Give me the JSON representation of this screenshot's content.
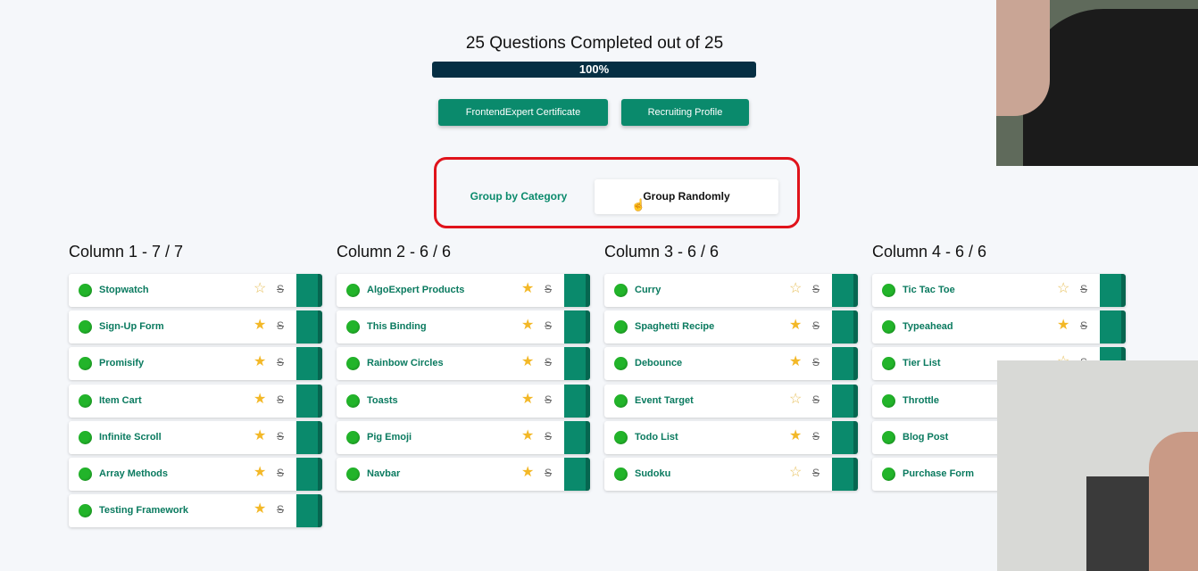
{
  "progress": {
    "title": "25 Questions Completed out of 25",
    "percent_label": "100%",
    "percent": 100
  },
  "buttons": {
    "certificate": "FrontendExpert Certificate",
    "recruiting": "Recruiting Profile"
  },
  "grouping": {
    "by_category": "Group by Category",
    "randomly": "Group Randomly",
    "selected": "randomly"
  },
  "colors": {
    "accent": "#0a8a6c",
    "dark_bar": "#062f43",
    "complete_dot": "#22b42a",
    "star": "#f3b827",
    "highlight": "#e0131b"
  },
  "columns": [
    {
      "title": "Column 1 - 7 / 7",
      "questions": [
        {
          "name": "Stopwatch",
          "starred": false
        },
        {
          "name": "Sign-Up Form",
          "starred": true
        },
        {
          "name": "Promisify",
          "starred": true
        },
        {
          "name": "Item Cart",
          "starred": true
        },
        {
          "name": "Infinite Scroll",
          "starred": true
        },
        {
          "name": "Array Methods",
          "starred": true
        },
        {
          "name": "Testing Framework",
          "starred": true
        }
      ]
    },
    {
      "title": "Column 2 - 6 / 6",
      "questions": [
        {
          "name": "AlgoExpert Products",
          "starred": true
        },
        {
          "name": "This Binding",
          "starred": true
        },
        {
          "name": "Rainbow Circles",
          "starred": true
        },
        {
          "name": "Toasts",
          "starred": true
        },
        {
          "name": "Pig Emoji",
          "starred": true
        },
        {
          "name": "Navbar",
          "starred": true
        }
      ]
    },
    {
      "title": "Column 3 - 6 / 6",
      "questions": [
        {
          "name": "Curry",
          "starred": false
        },
        {
          "name": "Spaghetti Recipe",
          "starred": true
        },
        {
          "name": "Debounce",
          "starred": true
        },
        {
          "name": "Event Target",
          "starred": false
        },
        {
          "name": "Todo List",
          "starred": true
        },
        {
          "name": "Sudoku",
          "starred": false
        }
      ]
    },
    {
      "title": "Column 4 - 6 / 6",
      "questions": [
        {
          "name": "Tic Tac Toe",
          "starred": false
        },
        {
          "name": "Typeahead",
          "starred": true
        },
        {
          "name": "Tier List",
          "starred": false
        },
        {
          "name": "Throttle",
          "starred": false
        },
        {
          "name": "Blog Post",
          "starred": false
        },
        {
          "name": "Purchase Form",
          "starred": false
        }
      ]
    }
  ],
  "icons": {
    "complete": "complete-dot-icon",
    "star": "star-icon",
    "strikethrough": "strikethrough-icon",
    "cursor": "hand-cursor-icon"
  }
}
